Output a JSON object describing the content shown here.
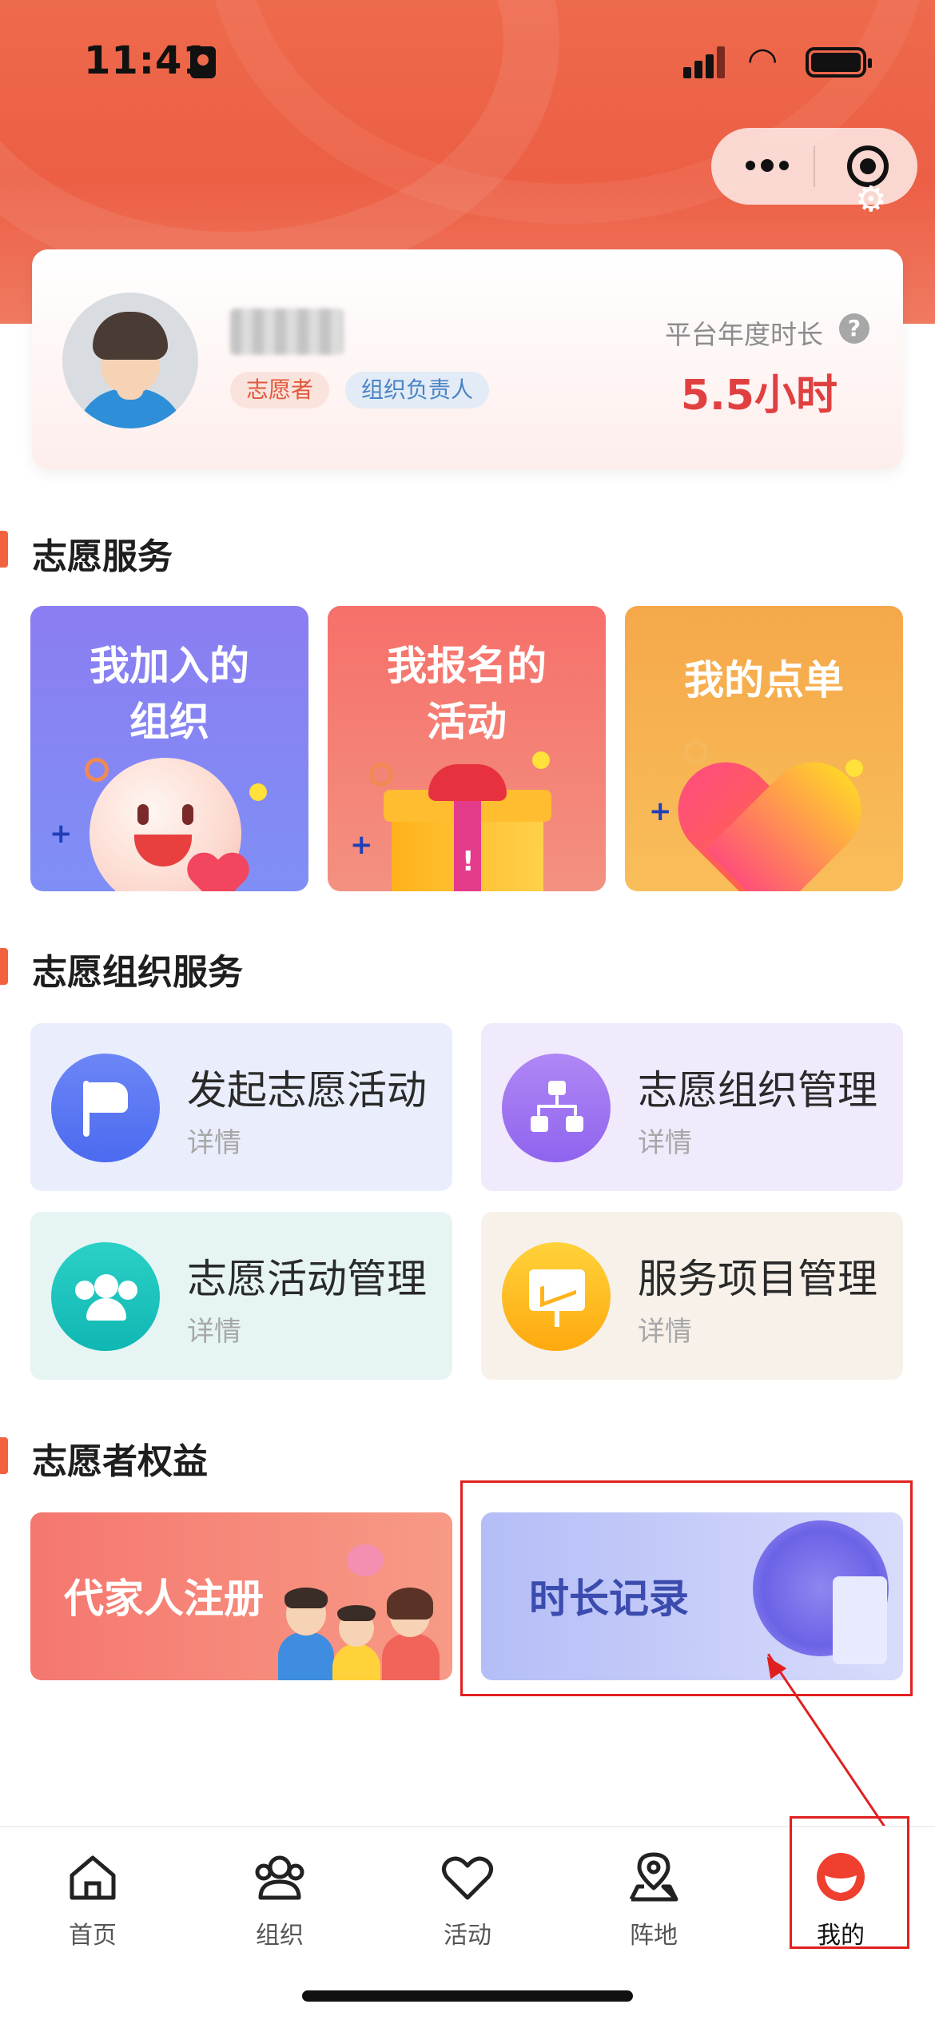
{
  "status_bar": {
    "time": "11:41"
  },
  "profile": {
    "tags": [
      "志愿者",
      "组织负责人"
    ],
    "hours_label": "平台年度时长",
    "hours_value": "5.5小时",
    "help": "?"
  },
  "sections": {
    "volunteer_service": "志愿服务",
    "org_service": "志愿组织服务",
    "rights": "志愿者权益"
  },
  "service_cards": [
    {
      "label_line1": "我加入的",
      "label_line2": "组织"
    },
    {
      "label_line1": "我报名的",
      "label_line2": "活动"
    },
    {
      "label_line1": "我的点单",
      "label_line2": ""
    }
  ],
  "org_cards": [
    {
      "title": "发起志愿活动",
      "sub": "详情",
      "icon": "flag-icon"
    },
    {
      "title": "志愿组织管理",
      "sub": "详情",
      "icon": "org-chart-icon"
    },
    {
      "title": "志愿活动管理",
      "sub": "详情",
      "icon": "group-icon"
    },
    {
      "title": "服务项目管理",
      "sub": "详情",
      "icon": "chart-board-icon"
    }
  ],
  "rights_cards": [
    {
      "label": "代家人注册"
    },
    {
      "label": "时长记录"
    }
  ],
  "tabbar": [
    {
      "label": "首页",
      "icon": "home-icon",
      "active": false
    },
    {
      "label": "组织",
      "icon": "group-icon",
      "active": false
    },
    {
      "label": "活动",
      "icon": "heart-icon",
      "active": false
    },
    {
      "label": "阵地",
      "icon": "location-icon",
      "active": false
    },
    {
      "label": "我的",
      "icon": "profile-icon",
      "active": true
    }
  ],
  "colors": {
    "header": "#ec5f45",
    "accent_red": "#e04040",
    "section_bar": "#f2623f",
    "annotation": "#e02020"
  }
}
